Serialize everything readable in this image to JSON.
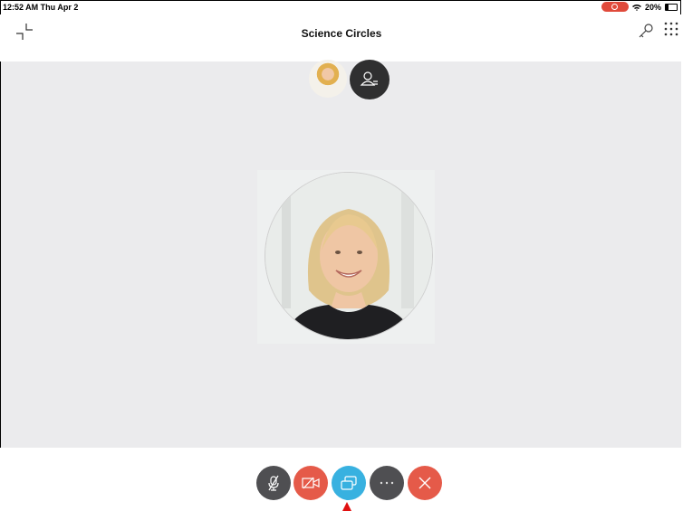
{
  "status_bar": {
    "time": "12:52 AM  Thu Apr 2",
    "battery": "20%",
    "icons": [
      "record-icon",
      "wifi-icon",
      "battery-icon"
    ]
  },
  "nav": {
    "title": "Science Circles",
    "icons": [
      "collapse-icon",
      "key-icon",
      "grid-icon"
    ]
  },
  "participants": {
    "icons": [
      "participant-thumbnail",
      "participant-list-icon"
    ]
  },
  "controls": {
    "icons": [
      "mute-microphone-icon",
      "video-off-icon",
      "share-screen-icon",
      "more-options-icon",
      "end-call-icon"
    ],
    "colors": {
      "mute": "#4f4f52",
      "video": "#e55a49",
      "share": "#38b1e0",
      "more": "#4f4f52",
      "end": "#e55a49"
    }
  }
}
